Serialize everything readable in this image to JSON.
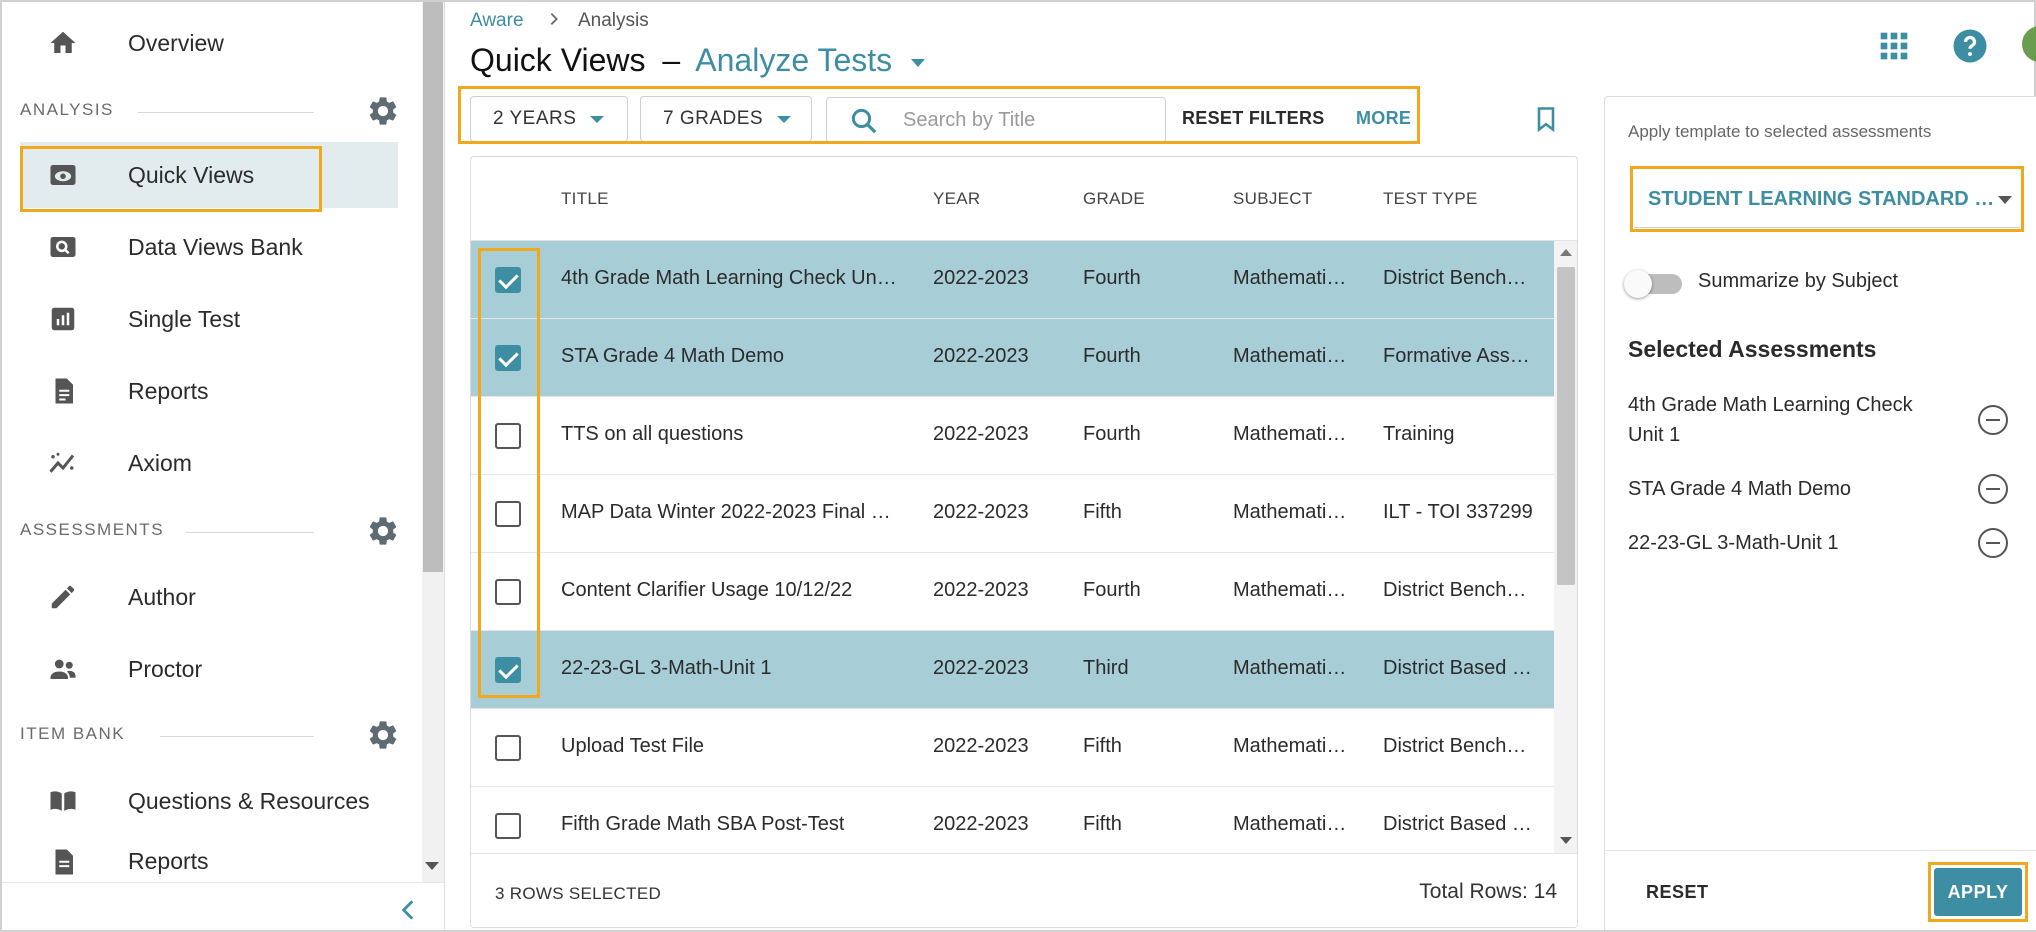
{
  "colors": {
    "accent": "#3d8ea3",
    "highlight": "#f2a81d",
    "selected_row": "#a7cdd6",
    "active_nav": "#e2ecef"
  },
  "sidebar": {
    "items": [
      {
        "label": "Overview",
        "icon": "home-icon"
      },
      {
        "label": "Quick Views",
        "icon": "eye-icon"
      },
      {
        "label": "Data Views Bank",
        "icon": "search-data-icon"
      },
      {
        "label": "Single Test",
        "icon": "bar-chart-icon"
      },
      {
        "label": "Reports",
        "icon": "document-icon"
      },
      {
        "label": "Axiom",
        "icon": "trend-icon"
      },
      {
        "label": "Author",
        "icon": "pencil-icon"
      },
      {
        "label": "Proctor",
        "icon": "people-icon"
      },
      {
        "label": "Questions & Resources",
        "icon": "book-icon"
      },
      {
        "label": "Reports",
        "icon": "document-icon"
      }
    ],
    "sections": {
      "analysis": "ANALYSIS",
      "assessments": "ASSESSMENTS",
      "item_bank": "ITEM BANK"
    }
  },
  "header": {
    "breadcrumb": {
      "root": "Aware",
      "current": "Analysis"
    },
    "title": "Quick Views",
    "dash": "–",
    "view_name": "Analyze Tests"
  },
  "filters": {
    "years": "2 YEARS",
    "grades": "7 GRADES",
    "search_placeholder": "Search by Title",
    "reset": "RESET FILTERS",
    "more": "MORE"
  },
  "table": {
    "columns": [
      "TITLE",
      "YEAR",
      "GRADE",
      "SUBJECT",
      "TEST TYPE"
    ],
    "rows": [
      {
        "title": "4th Grade Math Learning Check Un…",
        "year": "2022-2023",
        "grade": "Fourth",
        "subject": "Mathemati…",
        "type": "District Bench…",
        "checked": true
      },
      {
        "title": "STA Grade 4 Math Demo",
        "year": "2022-2023",
        "grade": "Fourth",
        "subject": "Mathemati…",
        "type": "Formative Ass…",
        "checked": true
      },
      {
        "title": "TTS on all questions",
        "year": "2022-2023",
        "grade": "Fourth",
        "subject": "Mathemati…",
        "type": "Training",
        "checked": false
      },
      {
        "title": "MAP Data Winter 2022-2023 Final …",
        "year": "2022-2023",
        "grade": "Fifth",
        "subject": "Mathemati…",
        "type": "ILT - TOI 337299",
        "checked": false
      },
      {
        "title": "Content Clarifier Usage 10/12/22",
        "year": "2022-2023",
        "grade": "Fourth",
        "subject": "Mathemati…",
        "type": "District Bench…",
        "checked": false
      },
      {
        "title": "22-23-GL 3-Math-Unit 1",
        "year": "2022-2023",
        "grade": "Third",
        "subject": "Mathemati…",
        "type": "District Based …",
        "checked": true
      },
      {
        "title": "Upload Test File",
        "year": "2022-2023",
        "grade": "Fifth",
        "subject": "Mathemati…",
        "type": "District Bench…",
        "checked": false
      },
      {
        "title": "Fifth Grade Math SBA Post-Test",
        "year": "2022-2023",
        "grade": "Fifth",
        "subject": "Mathemati…",
        "type": "District Based …",
        "checked": false
      }
    ],
    "footer": {
      "selected": "3 ROWS SELECTED",
      "total": "Total Rows: 14"
    }
  },
  "panel": {
    "caption": "Apply template to selected assessments",
    "template": "STUDENT LEARNING STANDARD …",
    "toggle_label": "Summarize by Subject",
    "heading": "Selected Assessments",
    "selected": [
      "4th Grade Math Learning Check Unit 1",
      "STA Grade 4 Math Demo",
      "22-23-GL 3-Math-Unit 1"
    ],
    "reset": "RESET",
    "apply": "APPLY"
  }
}
